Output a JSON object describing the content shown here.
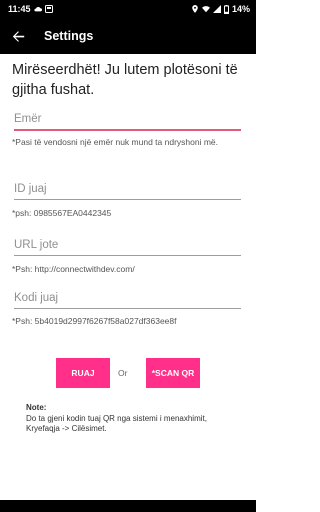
{
  "status_bar": {
    "time": "11:45",
    "battery": "14%",
    "icons_left": [
      "cloud-icon",
      "notification-box-icon"
    ],
    "icons_right": [
      "location-icon",
      "wifi-icon",
      "signal-icon",
      "battery-icon"
    ]
  },
  "app_bar": {
    "title": "Settings",
    "back_icon": "arrow-back-icon"
  },
  "welcome_text": "Mirëseerdhët! Ju lutem plotësoni të gjitha fushat.",
  "fields": {
    "name": {
      "placeholder": "Emër",
      "value": "",
      "hint": "*Pasi të vendosni një emër nuk mund ta ndryshoni më."
    },
    "user_id": {
      "placeholder": "ID juaj",
      "value": "",
      "hint": "*psh: 0985567EA0442345"
    },
    "url": {
      "placeholder": "URL jote",
      "value": "",
      "hint": "*Psh: http://connectwithdev.com/"
    },
    "code": {
      "placeholder": "Kodi juaj",
      "value": "",
      "hint": "*Psh: 5b4019d2997f6267f58a027df363ee8f"
    }
  },
  "buttons": {
    "save": "RUAJ",
    "or": "Or",
    "scan": "*SCAN QR"
  },
  "note": {
    "title": "Note:",
    "body": "Do ta gjeni kodin tuaj QR nga sistemi i menaxhimit, Kryefaqja -> Cilësimet."
  },
  "colors": {
    "accent": "#ff2f8a",
    "bar": "#000000",
    "field_active": "#e25a7a"
  }
}
